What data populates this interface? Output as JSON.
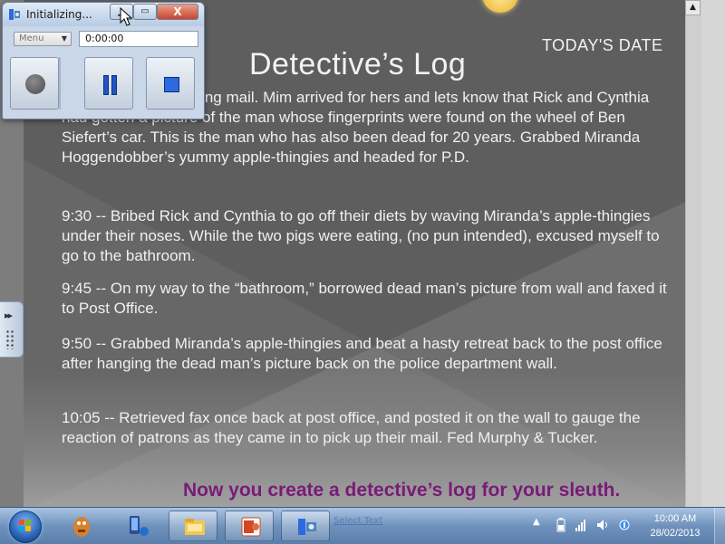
{
  "slide": {
    "date_label": "TODAY'S DATE",
    "title": "Detective’s Log",
    "paragraphs": [
      "work and began sorting mail. Mim arrived for hers and lets know that Rick and Cynthia had gotten a picture of the man whose fingerprints were found on the wheel of Ben Siefert’s car. This is the man who has also been dead for 20 years. Grabbed Miranda Hoggendobber’s yummy apple-thingies and headed for P.D.",
      "9:30 -- Bribed Rick and Cynthia to go off their diets by waving Miranda’s apple-thingies under their noses. While the two pigs were eating, (no pun intended), excused myself to go to the bathroom.",
      "9:45 -- On my way to the “bathroom,” borrowed dead man’s picture from wall and faxed it to Post Office.",
      "9:50 -- Grabbed Miranda’s apple-thingies and beat a hasty retreat back to the post office after hanging the dead man’s picture back on the police department wall.",
      "10:05 -- Retrieved fax once back at post office, and posted it on the wall to gauge the reaction of patrons as they came in to pick up their mail. Fed Murphy & Tucker."
    ],
    "call_to_action": "Now you create a detective’s log for your sleuth.",
    "colors": {
      "background": "#5e5e5e",
      "text": "#f0f0f0",
      "accent": "#7a1a78"
    }
  },
  "recorder": {
    "title": "Initializing...",
    "menu_label": "Menu",
    "time": "0:00:00",
    "controls": [
      "record-icon",
      "pause-icon",
      "stop-icon"
    ],
    "window_buttons": [
      "minimize-icon",
      "maximize-icon",
      "close-icon"
    ],
    "close_glyph": "X"
  },
  "side_tab": {
    "arrows": "▸▸"
  },
  "taskbar": {
    "start_icon": "windows-start-orb",
    "pinned": [
      "paint-icon",
      "phone-sync-icon",
      "file-explorer-icon",
      "powerpoint-icon",
      "recorder-icon"
    ],
    "ghost_link": "Select Text",
    "tray_icons": [
      "show-hidden-icons-arrow",
      "battery-icon",
      "network-signal-icon",
      "volume-icon",
      "sync-icon"
    ],
    "clock": {
      "time": "10:00 AM",
      "date": "28/02/2013"
    }
  }
}
